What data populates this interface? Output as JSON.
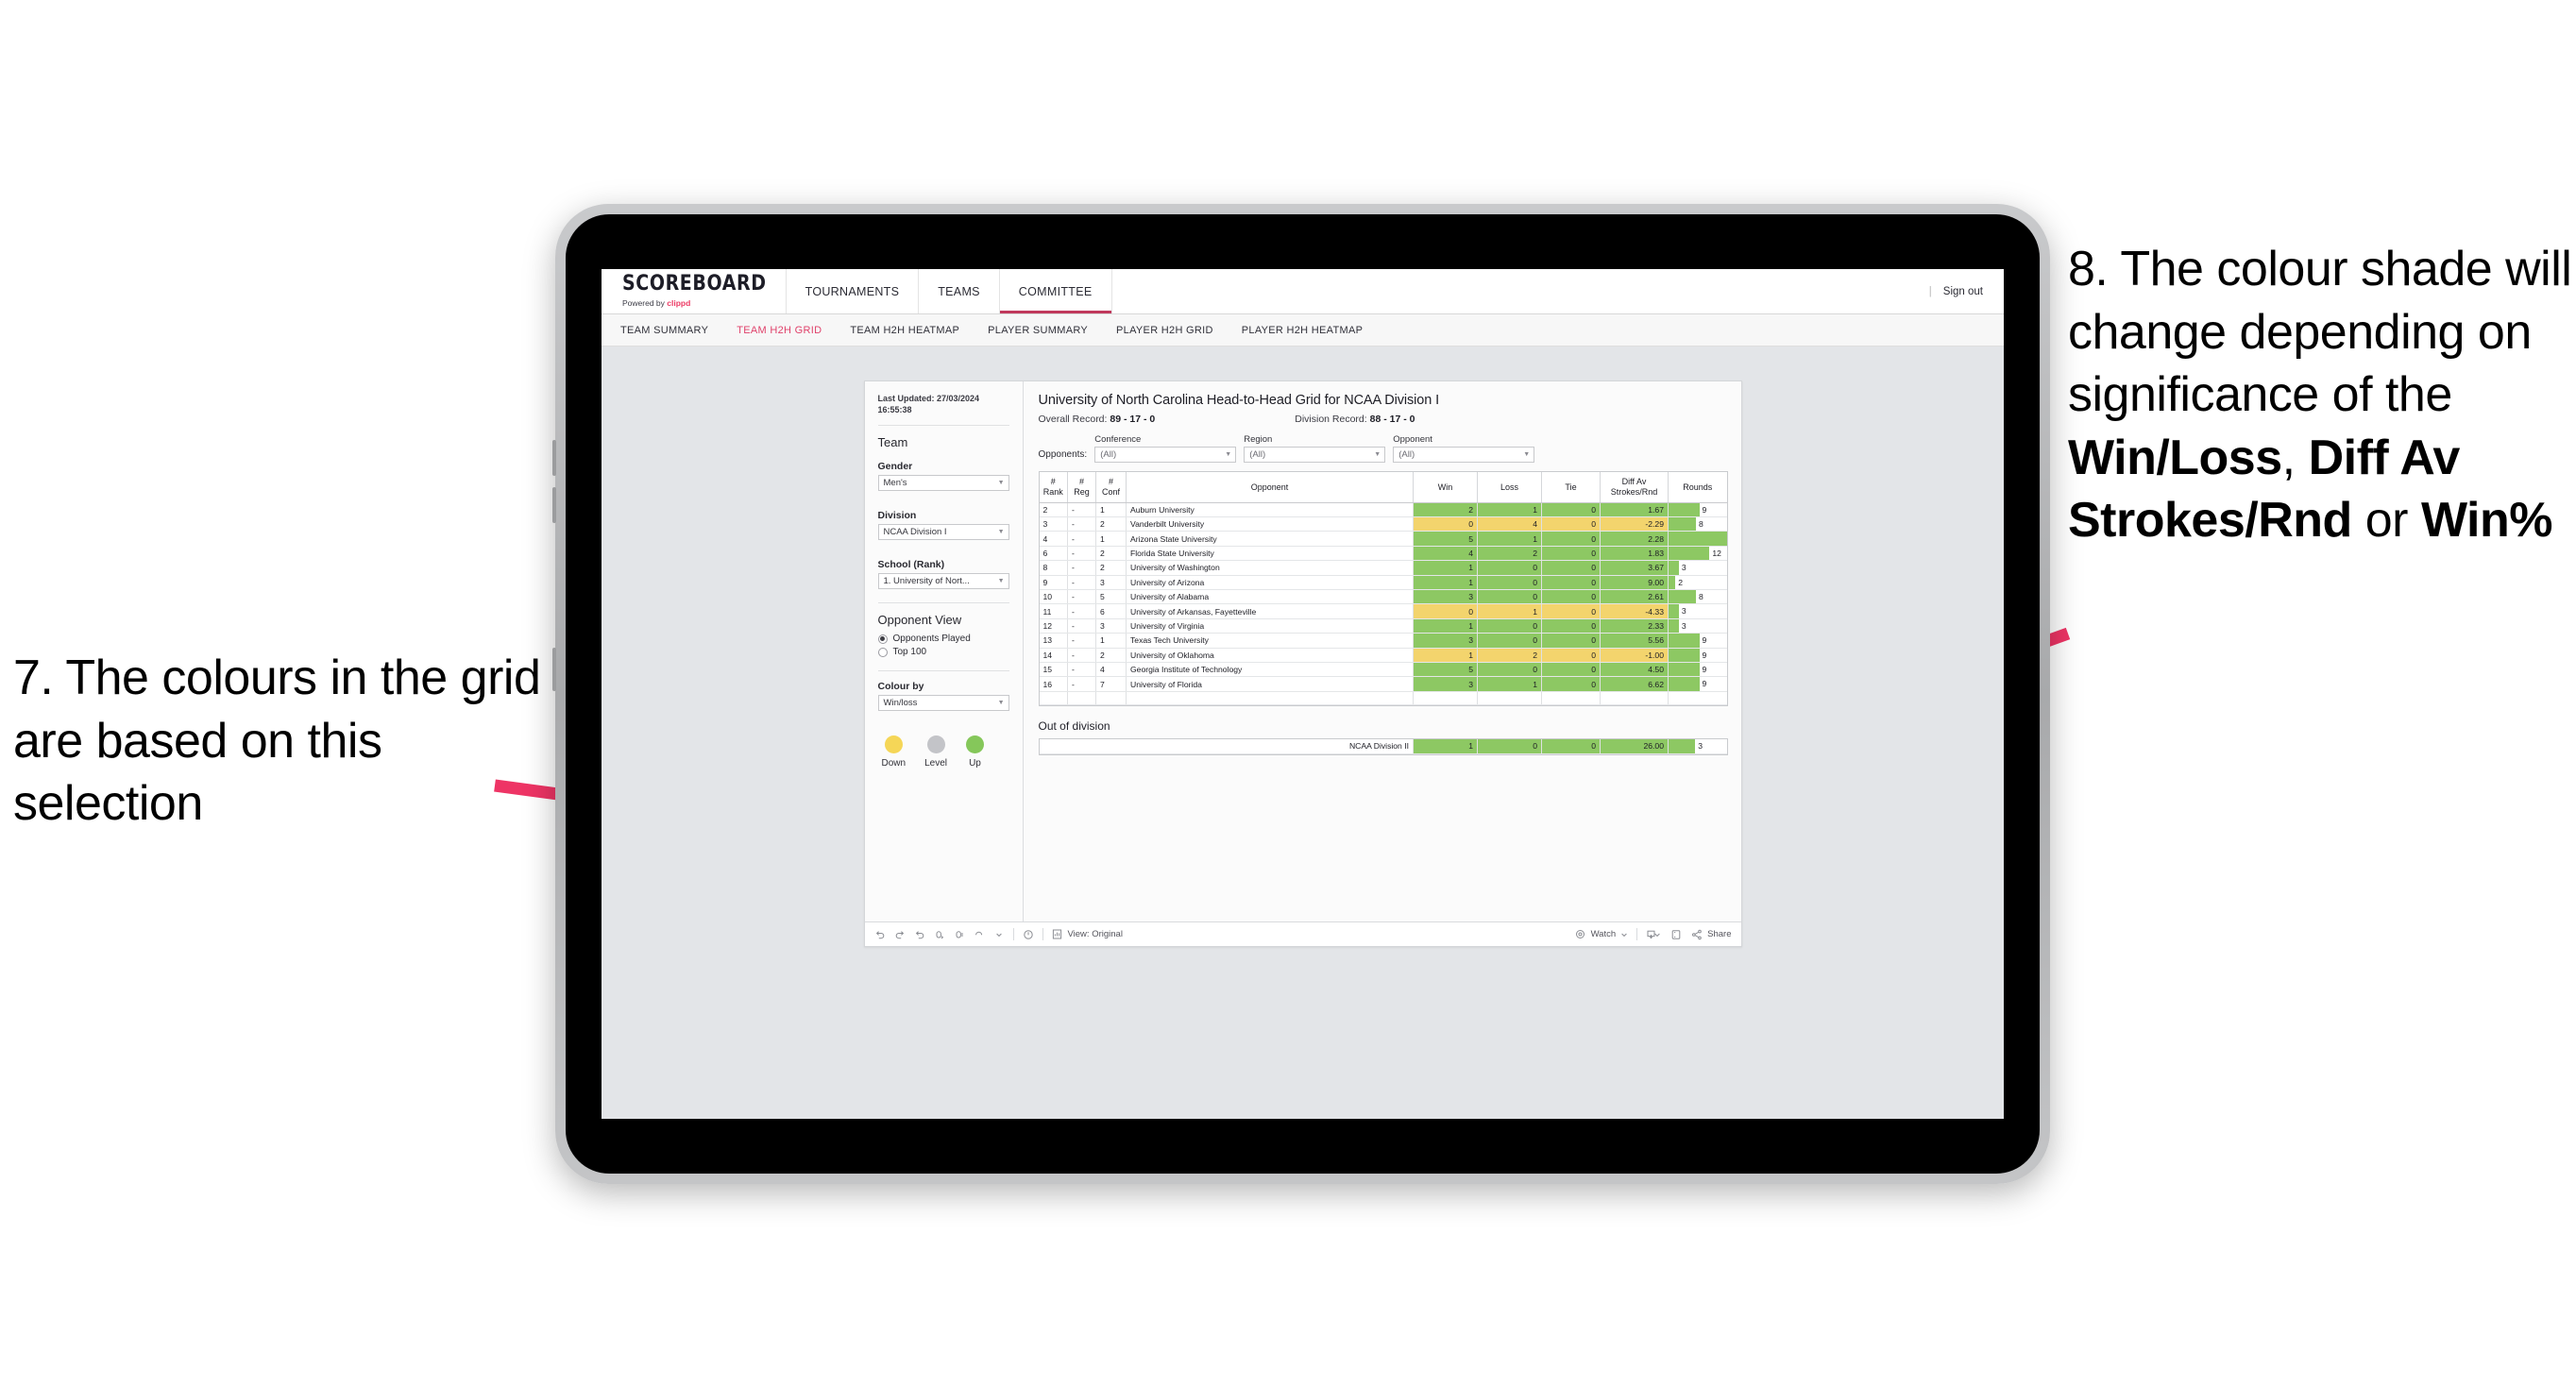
{
  "annotations": {
    "left": {
      "number": "7.",
      "text": "7. The colours in the grid are based on this selection"
    },
    "right": {
      "line1": "8. The colour shade will change depending on significance of the ",
      "bold1": "Win/Loss",
      "mid1": ", ",
      "bold2": "Diff Av Strokes/Rnd",
      "mid2": " or ",
      "bold3": "Win%"
    },
    "arrow_color": "#ee3465"
  },
  "app": {
    "brand": {
      "name": "SCOREBOARD",
      "powered_prefix": "Powered by ",
      "powered_brand": "clippd"
    },
    "topnav": [
      {
        "label": "TOURNAMENTS",
        "active": false
      },
      {
        "label": "TEAMS",
        "active": false
      },
      {
        "label": "COMMITTEE",
        "active": true
      }
    ],
    "signout": {
      "divider": "|",
      "label": "Sign out"
    },
    "subnav": [
      {
        "label": "TEAM SUMMARY",
        "active": false
      },
      {
        "label": "TEAM H2H GRID",
        "active": true
      },
      {
        "label": "TEAM H2H HEATMAP",
        "active": false
      },
      {
        "label": "PLAYER SUMMARY",
        "active": false
      },
      {
        "label": "PLAYER H2H GRID",
        "active": false
      },
      {
        "label": "PLAYER H2H HEATMAP",
        "active": false
      }
    ],
    "accent": "#e0426b"
  },
  "panel": {
    "last_updated": "Last Updated: 27/03/2024 16:55:38",
    "team_title": "Team",
    "gender": {
      "label": "Gender",
      "value": "Men's"
    },
    "division": {
      "label": "Division",
      "value": "NCAA Division I"
    },
    "school": {
      "label": "School (Rank)",
      "value": "1. University of Nort..."
    },
    "opponent_view": {
      "title": "Opponent View",
      "options": [
        {
          "label": "Opponents Played",
          "selected": true
        },
        {
          "label": "Top 100",
          "selected": false
        }
      ]
    },
    "colour_by": {
      "label": "Colour by",
      "value": "Win/loss"
    },
    "legend": [
      {
        "label": "Down",
        "color": "#f5d657"
      },
      {
        "label": "Level",
        "color": "#c3c4c8"
      },
      {
        "label": "Up",
        "color": "#85c75a"
      }
    ]
  },
  "main": {
    "title": "University of North Carolina Head-to-Head Grid for NCAA Division I",
    "overall_record_label": "Overall Record: ",
    "overall_record_value": "89 - 17 - 0",
    "division_record_label": "Division Record: ",
    "division_record_value": "88 - 17 - 0",
    "opponents_label": "Opponents:",
    "filters": [
      {
        "label": "Conference",
        "value": "(All)"
      },
      {
        "label": "Region",
        "value": "(All)"
      },
      {
        "label": "Opponent",
        "value": "(All)"
      }
    ],
    "columns": [
      {
        "line1": "#",
        "line2": "Rank"
      },
      {
        "line1": "#",
        "line2": "Reg"
      },
      {
        "line1": "#",
        "line2": "Conf"
      },
      {
        "line1": "Opponent",
        "line2": ""
      },
      {
        "line1": "Win",
        "line2": ""
      },
      {
        "line1": "Loss",
        "line2": ""
      },
      {
        "line1": "Tie",
        "line2": ""
      },
      {
        "line1": "Diff Av",
        "line2": "Strokes/Rnd"
      },
      {
        "line1": "Rounds",
        "line2": ""
      }
    ],
    "rows": [
      {
        "rank": "2",
        "reg": "-",
        "conf": "1",
        "opponent": "Auburn University",
        "win": "2",
        "loss": "1",
        "tie": "0",
        "diff": "1.67",
        "rounds": "9",
        "shade": "up"
      },
      {
        "rank": "3",
        "reg": "-",
        "conf": "2",
        "opponent": "Vanderbilt University",
        "win": "0",
        "loss": "4",
        "tie": "0",
        "diff": "-2.29",
        "rounds": "8",
        "shade": "down"
      },
      {
        "rank": "4",
        "reg": "-",
        "conf": "1",
        "opponent": "Arizona State University",
        "win": "5",
        "loss": "1",
        "tie": "0",
        "diff": "2.28",
        "rounds": "17",
        "shade": "up"
      },
      {
        "rank": "6",
        "reg": "-",
        "conf": "2",
        "opponent": "Florida State University",
        "win": "4",
        "loss": "2",
        "tie": "0",
        "diff": "1.83",
        "rounds": "12",
        "shade": "up"
      },
      {
        "rank": "8",
        "reg": "-",
        "conf": "2",
        "opponent": "University of Washington",
        "win": "1",
        "loss": "0",
        "tie": "0",
        "diff": "3.67",
        "rounds": "3",
        "shade": "up"
      },
      {
        "rank": "9",
        "reg": "-",
        "conf": "3",
        "opponent": "University of Arizona",
        "win": "1",
        "loss": "0",
        "tie": "0",
        "diff": "9.00",
        "rounds": "2",
        "shade": "up"
      },
      {
        "rank": "10",
        "reg": "-",
        "conf": "5",
        "opponent": "University of Alabama",
        "win": "3",
        "loss": "0",
        "tie": "0",
        "diff": "2.61",
        "rounds": "8",
        "shade": "up"
      },
      {
        "rank": "11",
        "reg": "-",
        "conf": "6",
        "opponent": "University of Arkansas, Fayetteville",
        "win": "0",
        "loss": "1",
        "tie": "0",
        "diff": "-4.33",
        "rounds": "3",
        "shade": "down"
      },
      {
        "rank": "12",
        "reg": "-",
        "conf": "3",
        "opponent": "University of Virginia",
        "win": "1",
        "loss": "0",
        "tie": "0",
        "diff": "2.33",
        "rounds": "3",
        "shade": "up"
      },
      {
        "rank": "13",
        "reg": "-",
        "conf": "1",
        "opponent": "Texas Tech University",
        "win": "3",
        "loss": "0",
        "tie": "0",
        "diff": "5.56",
        "rounds": "9",
        "shade": "up"
      },
      {
        "rank": "14",
        "reg": "-",
        "conf": "2",
        "opponent": "University of Oklahoma",
        "win": "1",
        "loss": "2",
        "tie": "0",
        "diff": "-1.00",
        "rounds": "9",
        "shade": "down"
      },
      {
        "rank": "15",
        "reg": "-",
        "conf": "4",
        "opponent": "Georgia Institute of Technology",
        "win": "5",
        "loss": "0",
        "tie": "0",
        "diff": "4.50",
        "rounds": "9",
        "shade": "up"
      },
      {
        "rank": "16",
        "reg": "-",
        "conf": "7",
        "opponent": "University of Florida",
        "win": "3",
        "loss": "1",
        "tie": "0",
        "diff": "6.62",
        "rounds": "9",
        "shade": "up"
      }
    ],
    "rounds_max": 17,
    "out_of_division": {
      "title": "Out of division",
      "row": {
        "opponent": "NCAA Division II",
        "win": "1",
        "loss": "0",
        "tie": "0",
        "diff": "26.00",
        "rounds": "3",
        "shade": "up"
      }
    },
    "shade_colors": {
      "up": "#8dc863",
      "down": "#f3d46d",
      "level": "#c3c4c8",
      "bar": "#8dc863"
    }
  },
  "toolbar": {
    "icons": [
      "undo-icon",
      "redo-icon",
      "revert-icon",
      "refresh-icon",
      "pause-icon",
      "reset-icon",
      "caret-down-icon",
      "help-icon"
    ],
    "view_label": "View: Original",
    "watch_label": "Watch",
    "share_label": "Share"
  }
}
